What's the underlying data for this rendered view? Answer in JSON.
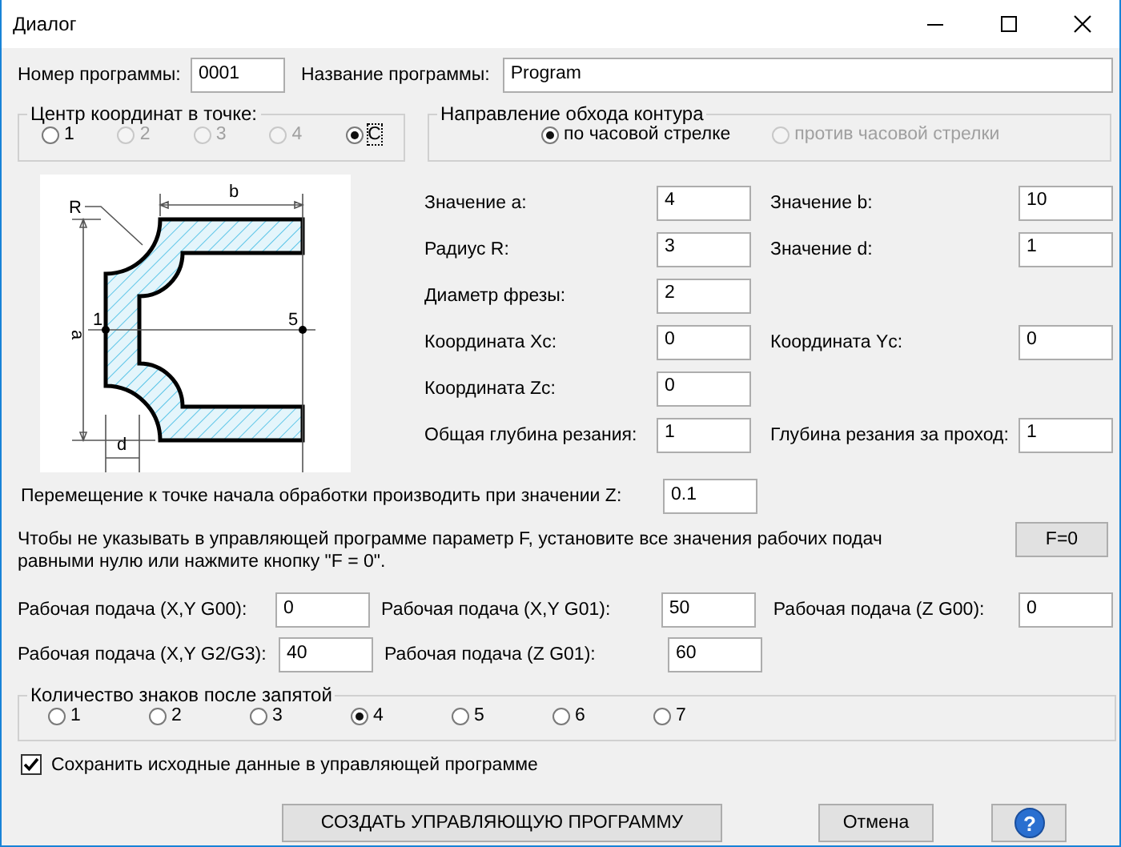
{
  "window": {
    "title": "Диалог"
  },
  "program": {
    "number_label": "Номер программы:",
    "number_value": "0001",
    "name_label": "Название программы:",
    "name_value": "Program"
  },
  "center_group": {
    "title": "Центр координат в точке:",
    "options": [
      {
        "label": "1",
        "selected": false,
        "disabled": false
      },
      {
        "label": "2",
        "selected": false,
        "disabled": true
      },
      {
        "label": "3",
        "selected": false,
        "disabled": true
      },
      {
        "label": "4",
        "selected": false,
        "disabled": true
      },
      {
        "label": "C",
        "selected": true,
        "disabled": false
      }
    ]
  },
  "drawing": {
    "label_b": "b",
    "label_r": "R",
    "label_a": "a",
    "label_point_1": "1",
    "label_point_5": "5",
    "label_d": "d"
  },
  "direction_group": {
    "title": "Направление обхода контура",
    "options": [
      {
        "label": "по часовой стрелке",
        "selected": true,
        "disabled": false
      },
      {
        "label": "против часовой стрелки",
        "selected": false,
        "disabled": true
      }
    ]
  },
  "params": [
    [
      {
        "label": "Значение a:",
        "value": "4"
      },
      {
        "label": "Значение b:",
        "value": "10"
      }
    ],
    [
      {
        "label": "Радиус R:",
        "value": "3"
      },
      {
        "label": "Значение d:",
        "value": "1"
      }
    ],
    [
      {
        "label": "Диаметр фрезы:",
        "value": "2"
      }
    ],
    [
      {
        "label": "Координата Xc:",
        "value": "0"
      },
      {
        "label": "Координата Yc:",
        "value": "0"
      }
    ],
    [
      {
        "label": "Координата Zc:",
        "value": "0"
      }
    ],
    [
      {
        "label": "Общая глубина резания:",
        "value": "1"
      },
      {
        "label": "Глубина резания за проход:",
        "value": "1"
      }
    ]
  ],
  "approach": {
    "label": "Перемещение к точке начала обработки производить при значении Z:",
    "value": "0.1"
  },
  "feed_note": {
    "text": "Чтобы не указывать в управляющей программе параметр F, установите все значения рабочих подач равными нулю или нажмите кнопку \"F = 0\".",
    "button": "F=0"
  },
  "feeds": [
    [
      {
        "label": "Рабочая подача (X,Y G00):",
        "value": "0"
      },
      {
        "label": "Рабочая подача (X,Y G01):",
        "value": "50"
      },
      {
        "label": "Рабочая подача (Z G00):",
        "value": "0"
      }
    ],
    [
      {
        "label": "Рабочая подача (X,Y G2/G3):",
        "value": "40"
      },
      {
        "label": "Рабочая подача (Z G01):",
        "value": "60"
      }
    ]
  ],
  "digits_group": {
    "title": "Количество знаков после запятой",
    "options": [
      {
        "label": "1",
        "selected": false
      },
      {
        "label": "2",
        "selected": false
      },
      {
        "label": "3",
        "selected": false
      },
      {
        "label": "4",
        "selected": true
      },
      {
        "label": "5",
        "selected": false
      },
      {
        "label": "6",
        "selected": false
      },
      {
        "label": "7",
        "selected": false
      }
    ]
  },
  "save_checkbox": {
    "label": "Сохранить исходные данные в управляющей программе",
    "checked": true
  },
  "buttons": {
    "create": "СОЗДАТЬ УПРАВЛЯЮЩУЮ ПРОГРАММУ",
    "cancel": "Отмена",
    "help": "?"
  }
}
